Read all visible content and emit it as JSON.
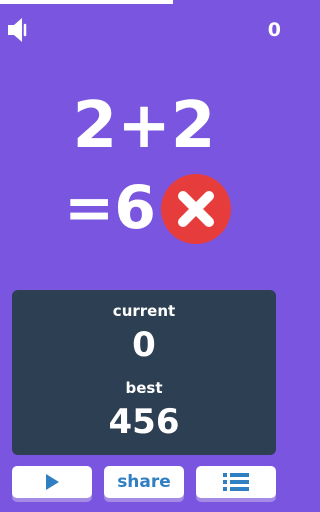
{
  "hud": {
    "score": "0",
    "timer_progress": 0.6
  },
  "question": {
    "expression": "2+2",
    "answer": "=6",
    "verdict_icon": "wrong-x-icon"
  },
  "scoreboard": {
    "current_label": "current",
    "current_value": "0",
    "best_label": "best",
    "best_value": "456"
  },
  "buttons": {
    "play_icon": "play-icon",
    "share_label": "share",
    "menu_icon": "list-menu-icon"
  },
  "colors": {
    "background": "#7a55e0",
    "panel": "#2d3f52",
    "wrong": "#e63c3c",
    "button_text": "#2f7fc2"
  }
}
